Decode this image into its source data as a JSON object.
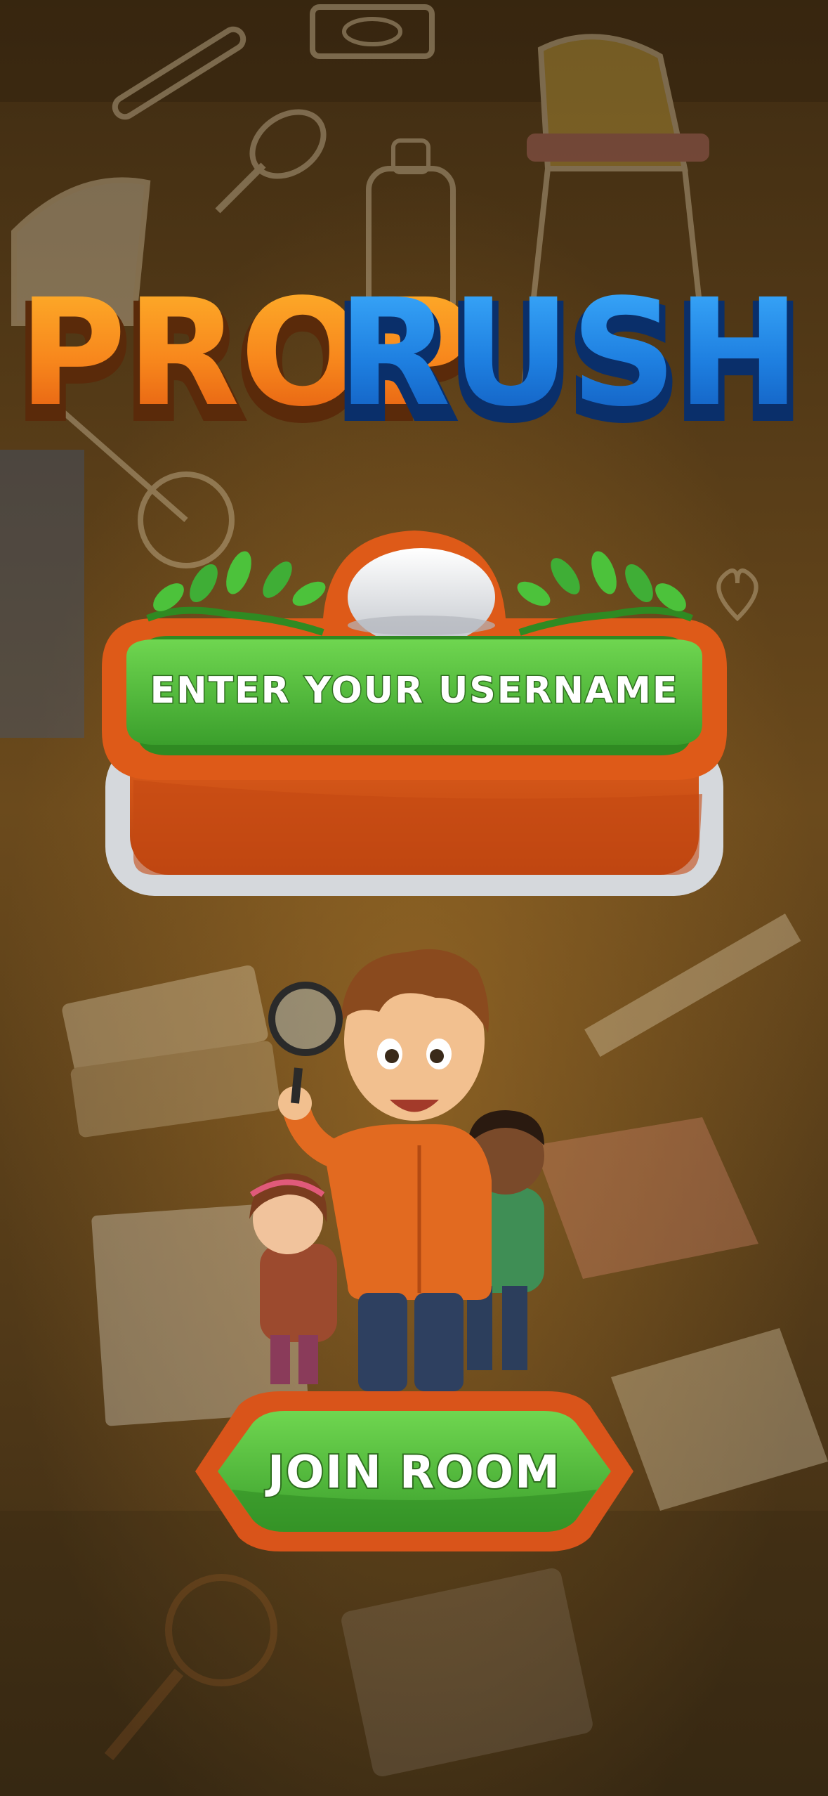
{
  "logo": {
    "part1": "PROP",
    "part2": "RUSH"
  },
  "username_panel": {
    "placeholder": "ENTER YOUR USERNAME",
    "value": ""
  },
  "join_button": {
    "label": "JOIN ROOM"
  },
  "colors": {
    "background": "#4a3417",
    "logo_orange": "#f7861c",
    "logo_blue": "#1e7fe0",
    "panel_orange": "#d9541a",
    "button_green": "#4cb83a",
    "leaf_green": "#3fae36",
    "silver_rim": "#c9ccd0"
  }
}
